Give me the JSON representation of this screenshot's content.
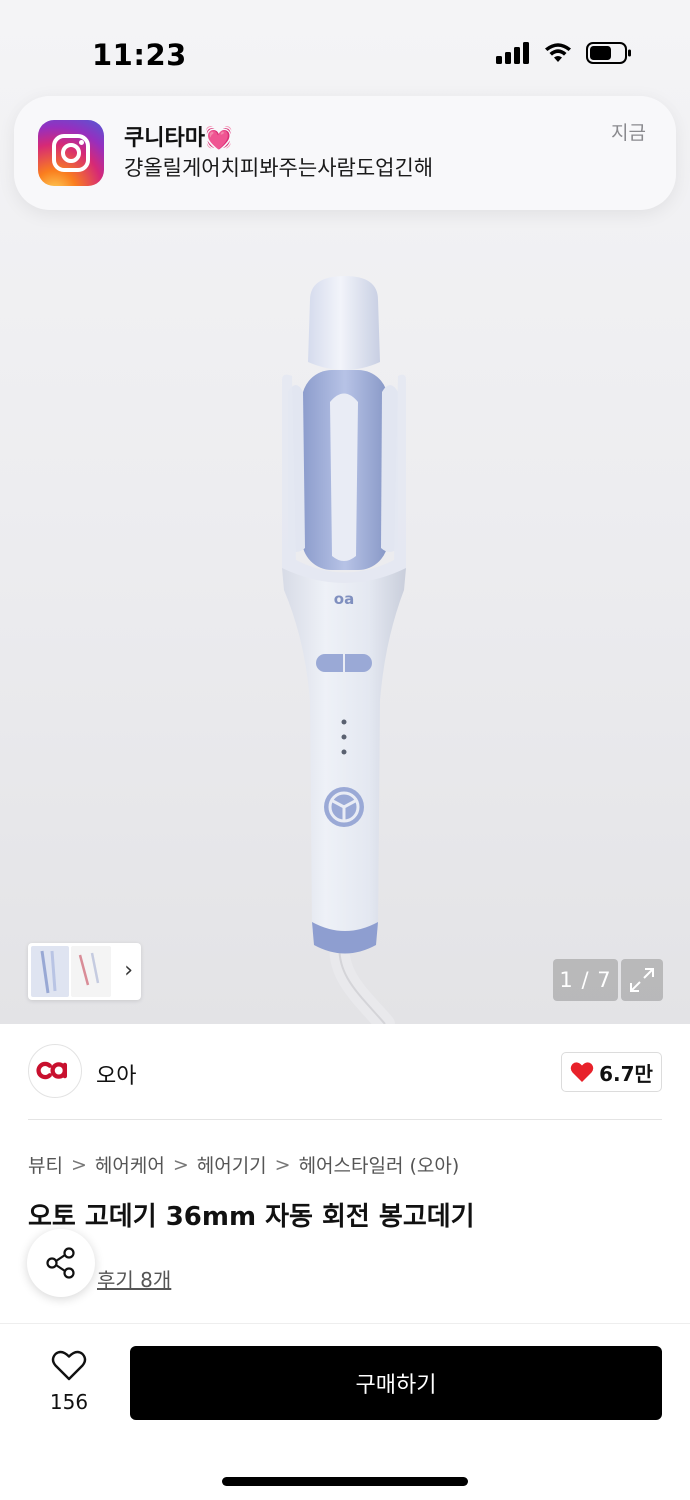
{
  "status_bar": {
    "time": "11:23"
  },
  "notification": {
    "app_icon": "instagram-icon",
    "title": "쿠니타마💓",
    "body": "걍올릴게어치피봐주는사람도업긴해",
    "time": "지금"
  },
  "gallery": {
    "counter": "1 / 7",
    "thumbnail_chevron": "›",
    "expand_icon": "expand-icon"
  },
  "brand": {
    "name": "오아",
    "logo_icon": "oa-logo-icon",
    "like_count": "6.7만",
    "like_color": "#e8212a"
  },
  "breadcrumb": [
    "뷰티",
    "헤어케어",
    "헤어기기",
    "헤어스타일러 (오아)"
  ],
  "breadcrumb_separator": ">",
  "product": {
    "title": "오토 고데기 36mm 자동 회전 봉고데기",
    "reviews_label": "후기 8개"
  },
  "bottom_bar": {
    "wish_count": "156",
    "buy_label": "구매하기"
  },
  "colors": {
    "accent": "#000000",
    "brand_red": "#c8102e",
    "device_body": "#e6eaf3",
    "device_accent": "#8da0cf"
  }
}
